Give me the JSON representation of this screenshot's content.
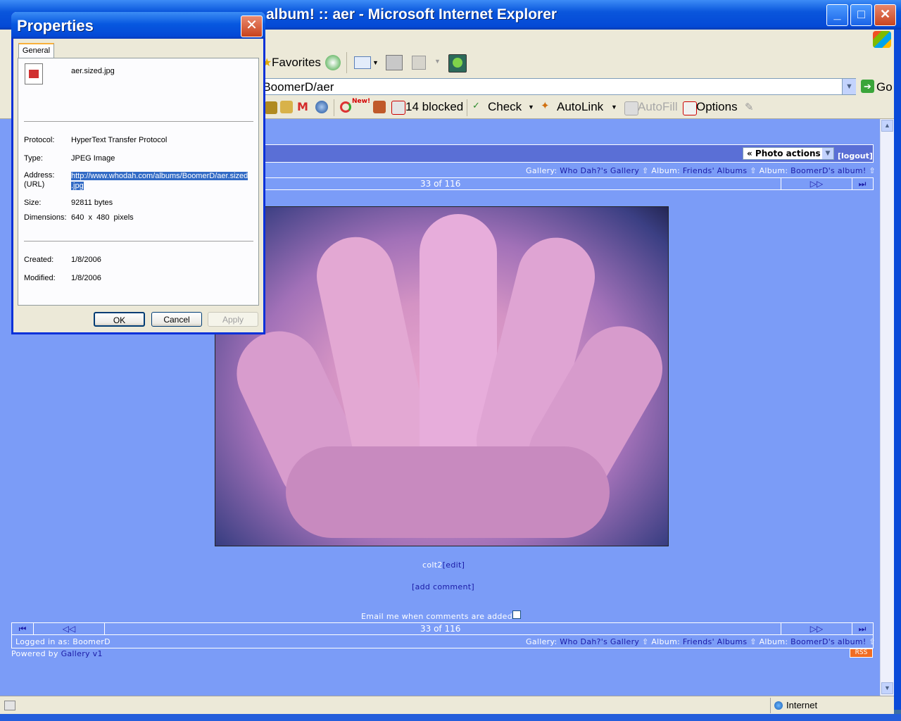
{
  "ie": {
    "title": "Who Dah?'s Gallery :: BoomerD's album! :: aer - Microsoft Internet Explorer",
    "visible_title": "album! :: aer - Microsoft Internet Explorer",
    "favorites": "Favorites",
    "address": "ery/BoomerD/aer",
    "go": "Go",
    "popups_blocked": "14 blocked",
    "check": "Check",
    "autolink": "AutoLink",
    "autofill": "AutoFill",
    "options": "Options",
    "new_badge": "New!",
    "status_zone": "Internet"
  },
  "gallery": {
    "photo_actions": "« Photo actions »",
    "logout": "[logout]",
    "breadcrumb_gallery_prefix": "Gallery:",
    "breadcrumb_gallery": "Who Dah?'s Gallery",
    "breadcrumb_album1_prefix": "Album:",
    "breadcrumb_album1": "Friends' Albums",
    "breadcrumb_album2_prefix": "Album:",
    "breadcrumb_album2": "BoomerD's album!",
    "position": "33 of 116",
    "caption_user": "colt2",
    "caption_edit": "[edit]",
    "add_comment": "[add comment]",
    "email_label": "Email me when comments are added",
    "logged_in": "Logged in as: BoomerD",
    "powered_prefix": "Powered by",
    "powered_link": "Gallery v1",
    "rss": "RSS"
  },
  "dialog": {
    "title": "Properties",
    "tab": "General",
    "filename": "aer.sized.jpg",
    "protocol_label": "Protocol:",
    "protocol": "HyperText Transfer Protocol",
    "type_label": "Type:",
    "type": "JPEG Image",
    "address_label": "Address:",
    "address_label2": "(URL)",
    "address_line1": "http://www.whodah.com/albums/BoomerD/aer.sized",
    "address_line2": ".jpg",
    "size_label": "Size:",
    "size": "92811 bytes",
    "dimensions_label": "Dimensions:",
    "dimensions": "640  x  480  pixels",
    "created_label": "Created:",
    "created": "1/8/2006",
    "modified_label": "Modified:",
    "modified": "1/8/2006",
    "ok": "OK",
    "cancel": "Cancel",
    "apply": "Apply"
  }
}
